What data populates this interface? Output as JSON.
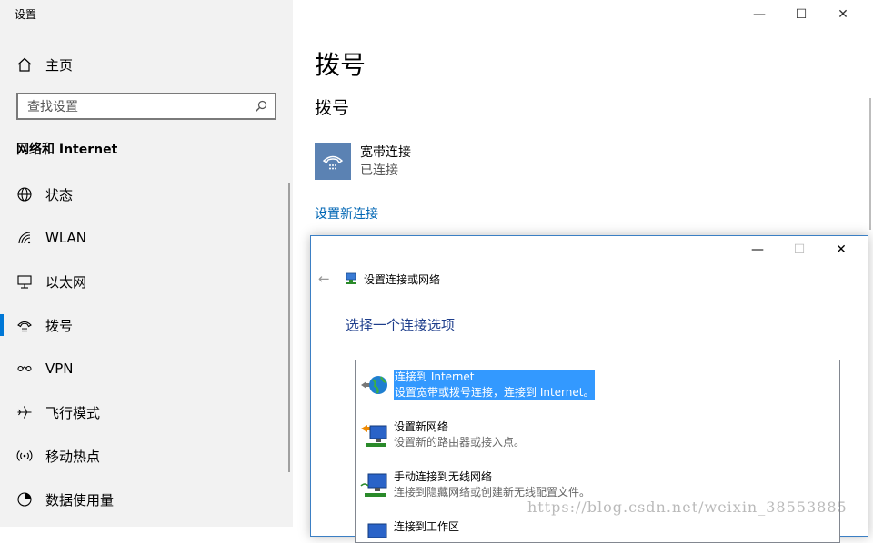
{
  "app": {
    "title": "设置"
  },
  "window_controls": {
    "minimize": "—",
    "maximize": "☐",
    "close": "✕"
  },
  "sidebar": {
    "home_label": "主页",
    "search_placeholder": "查找设置",
    "section_title": "网络和 Internet",
    "items": [
      {
        "label": "状态",
        "icon": "globe-icon"
      },
      {
        "label": "WLAN",
        "icon": "wifi-icon"
      },
      {
        "label": "以太网",
        "icon": "ethernet-icon"
      },
      {
        "label": "拨号",
        "icon": "phone-icon",
        "active": true
      },
      {
        "label": "VPN",
        "icon": "vpn-icon"
      },
      {
        "label": "飞行模式",
        "icon": "airplane-icon"
      },
      {
        "label": "移动热点",
        "icon": "hotspot-icon"
      },
      {
        "label": "数据使用量",
        "icon": "data-usage-icon"
      }
    ]
  },
  "main": {
    "title": "拨号",
    "subtitle": "拨号",
    "connection": {
      "name": "宽带连接",
      "status": "已连接"
    },
    "setup_link": "设置新连接"
  },
  "dialog": {
    "title": "设置连接或网络",
    "heading": "选择一个连接选项",
    "options": [
      {
        "title": "连接到 Internet",
        "desc": "设置宽带或拨号连接，连接到 Internet。",
        "selected": true
      },
      {
        "title": "设置新网络",
        "desc": "设置新的路由器或接入点。"
      },
      {
        "title": "手动连接到无线网络",
        "desc": "连接到隐藏网络或创建新无线配置文件。"
      },
      {
        "title": "连接到工作区",
        "desc": ""
      }
    ]
  },
  "watermark": "https://blog.csdn.net/weixin_38553885",
  "colors": {
    "accent": "#0078d7",
    "link": "#0066b4",
    "selection": "#3399ff",
    "tile": "#5b82b3"
  }
}
